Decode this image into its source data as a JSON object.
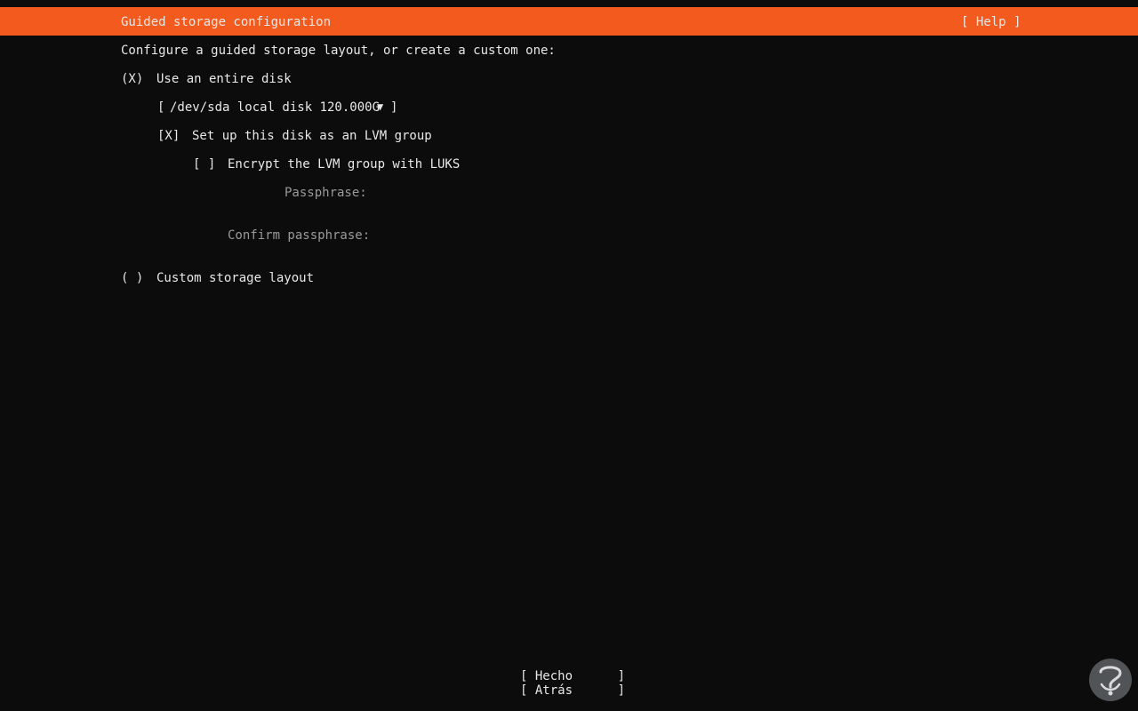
{
  "header": {
    "title": "Guided storage configuration",
    "help_label": "[ Help ]"
  },
  "intro": "Configure a guided storage layout, or create a custom one:",
  "options": {
    "entire_disk": {
      "marker": "(X)",
      "label": "Use an entire disk",
      "selected": true
    },
    "disk_select": {
      "open_bracket": "[",
      "value": "/dev/sda local disk 120.000G",
      "arrow": "▼",
      "close_bracket": "]"
    },
    "lvm": {
      "marker": "[X]",
      "label": "Set up this disk as an LVM group",
      "checked": true
    },
    "encrypt": {
      "marker": "[ ]",
      "label": "Encrypt the LVM group with LUKS",
      "checked": false
    },
    "passphrase": {
      "label": "Passphrase:",
      "value": ""
    },
    "confirm_passphrase": {
      "label": "Confirm passphrase:",
      "value": ""
    },
    "custom": {
      "marker": "( )",
      "label": "Custom storage layout",
      "selected": false
    }
  },
  "footer": {
    "done_label": "[ Hecho      ]",
    "back_label": "[ Atrás      ]"
  },
  "colors": {
    "header_bg": "#f25a1e",
    "background": "#0c0c0c",
    "text": "#e8e8e8",
    "dim_text": "#9a9a9a"
  }
}
